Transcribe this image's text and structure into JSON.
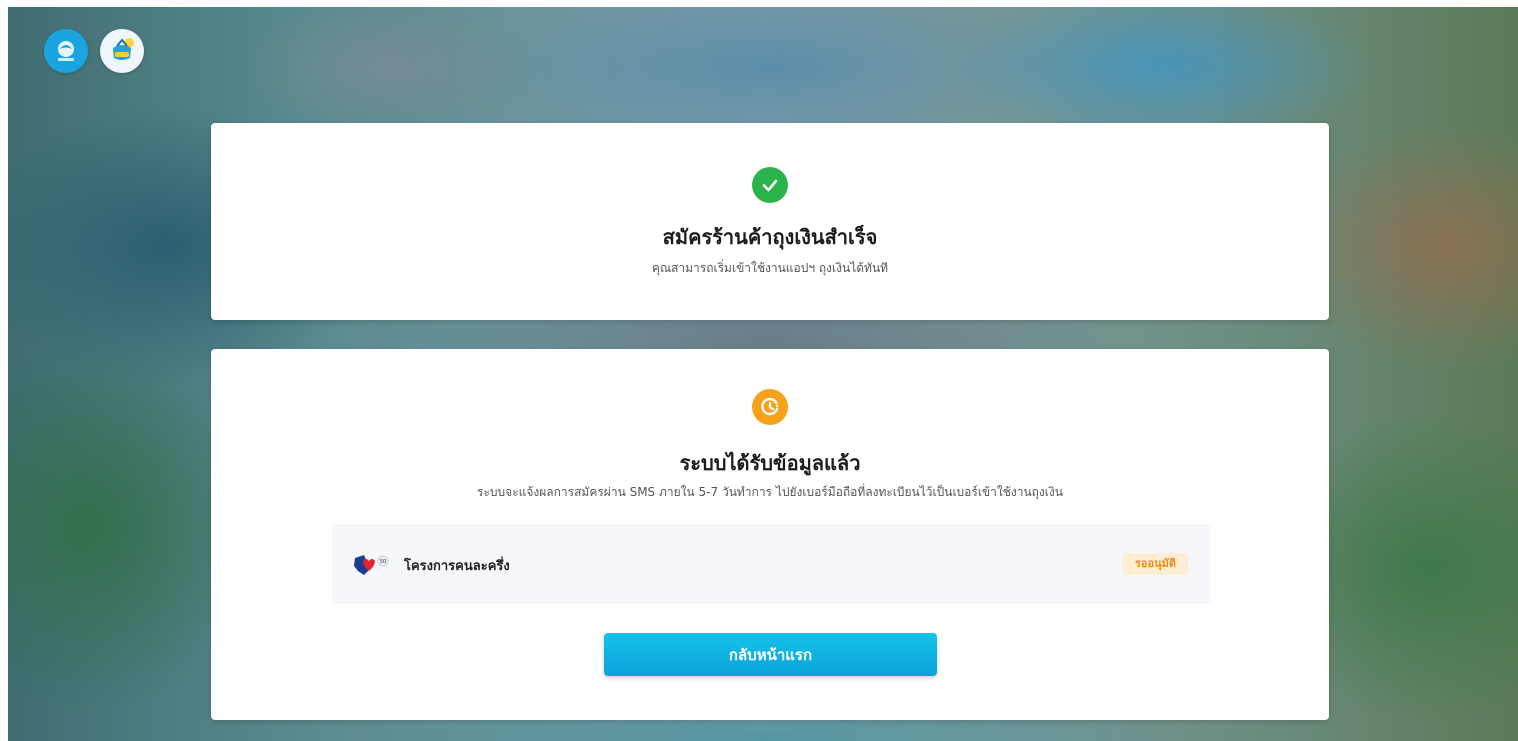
{
  "colors": {
    "success": "#2bb24a",
    "pending": "#f5a11a",
    "primary_button": "#0aa2d8",
    "badge_bg": "#fdeed3",
    "badge_text": "#ef8c1a"
  },
  "header": {
    "logos": [
      {
        "name": "krungthai-logo"
      },
      {
        "name": "tungngern-logo"
      }
    ]
  },
  "success_card": {
    "icon": "check-circle-icon",
    "title": "สมัครร้านค้าถุงเงินสำเร็จ",
    "subtitle": "คุณสามารถเริ่มเข้าใช้งานแอปฯ ถุงเงินได้ทันที"
  },
  "status_card": {
    "icon": "clock-pending-icon",
    "title": "ระบบได้รับข้อมูลแล้ว",
    "subtitle": "ระบบจะแจ้งผลการสมัครผ่าน SMS ภายใน 5-7 วันทำการ ไปยังเบอร์มือถือที่ลงทะเบียนไว้เป็นเบอร์เข้าใช้งานถุงเงิน",
    "project": {
      "icon": "half-half-project-logo",
      "name": "โครงการคนละครึ่ง",
      "status": "รออนุมัติ"
    },
    "home_button": "กลับหน้าแรก"
  }
}
